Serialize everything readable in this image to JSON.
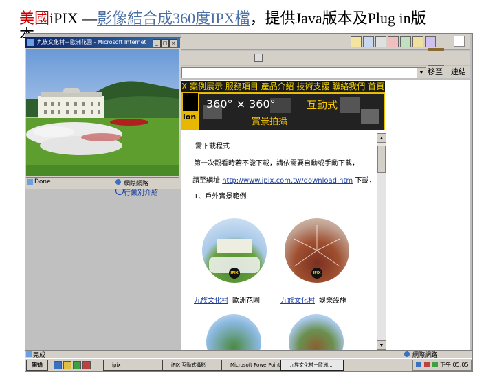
{
  "slide": {
    "title_red": "美國",
    "title_rest": "iPIX —",
    "title_link": "影像結合成360度IPX檔",
    "title_tail": "，提供Java版本及Plug in版",
    "title_wrap": "本"
  },
  "ie": {
    "go_label": "移至",
    "links_label": "連結 »"
  },
  "website": {
    "nav_text": "X 案例展示 服務項目 產品介紹 技術支援 聯絡我們 首頁",
    "banner_360": "360° × 360°",
    "banner_interactive": "互動式",
    "banner_sub": "實景拍攝",
    "banner_ion": "ion",
    "content_line_1": "需下載程式",
    "content_line_2": "第一次觀看時若不能下載，請依需要自動或手動下載，",
    "content_line_3_prefix": "請至網址 ",
    "content_url": "http://www.ipix.com.tw/download.htm",
    "content_line_3_suffix": " 下載，",
    "content_line_4": "1、戶外實景範例",
    "thumb_1_link": "九族文化村",
    "thumb_1_tail": "歐洲花園",
    "thumb_2_link": "九族文化村",
    "thumb_2_tail": "娛樂設施",
    "ipix_badge": "IPIX",
    "left_item": "行業別介紹"
  },
  "popup": {
    "title": "九族文化村－歐洲花園 - Microsoft Internet Explorer",
    "done": "Done",
    "zone": "網際網路"
  },
  "statusbar": {
    "done": "完成",
    "zone": "網際網路"
  },
  "taskbar": {
    "start": "開始",
    "tasks": [
      "ipix",
      "iPIX 互動式攝影",
      "Microsoft PowerPoint",
      "九族文化村－歐洲..."
    ],
    "clock": "下午 05:05"
  }
}
